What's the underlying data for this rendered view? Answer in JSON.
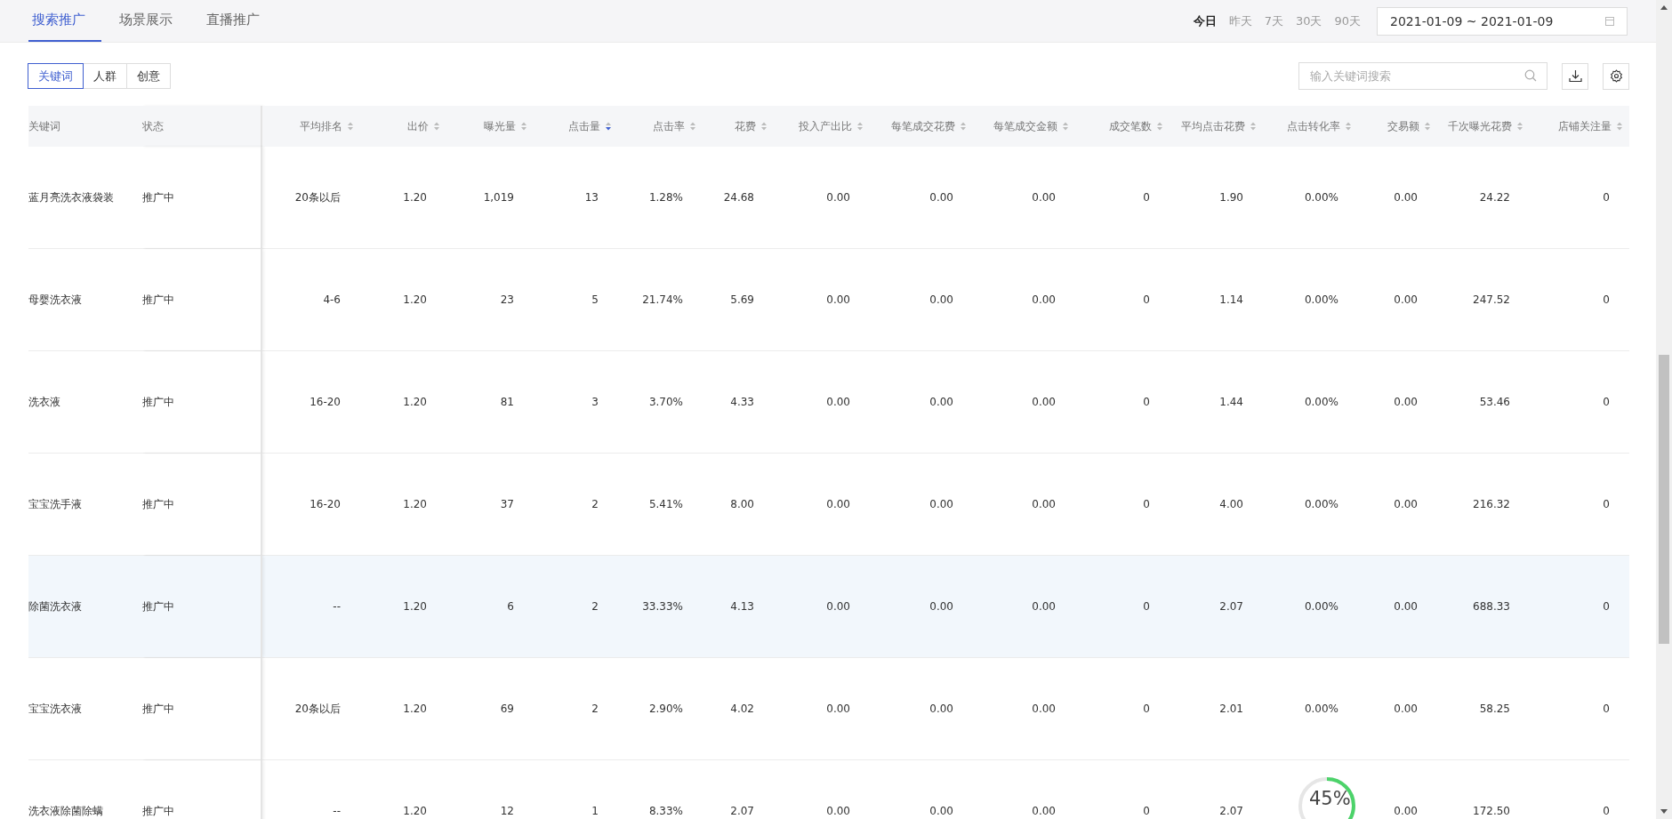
{
  "tabs": [
    {
      "label": "搜索推广",
      "selected": true
    },
    {
      "label": "场景展示",
      "selected": false
    },
    {
      "label": "直播推广",
      "selected": false
    }
  ],
  "date_ranges": [
    {
      "label": "今日",
      "selected": true
    },
    {
      "label": "昨天",
      "selected": false
    },
    {
      "label": "7天",
      "selected": false
    },
    {
      "label": "30天",
      "selected": false
    },
    {
      "label": "90天",
      "selected": false
    }
  ],
  "date_field": {
    "value": "2021-01-09 ~ 2021-01-09"
  },
  "segments": [
    {
      "label": "关键词",
      "selected": true
    },
    {
      "label": "人群",
      "selected": false
    },
    {
      "label": "创意",
      "selected": false
    }
  ],
  "search": {
    "placeholder": "输入关键词搜索"
  },
  "table": {
    "fixed_columns": [
      "关键词",
      "状态"
    ],
    "columns": [
      {
        "label": "平均排名",
        "sorted": false
      },
      {
        "label": "出价",
        "sorted": false
      },
      {
        "label": "曝光量",
        "sorted": false
      },
      {
        "label": "点击量",
        "sorted": true
      },
      {
        "label": "点击率",
        "sorted": false
      },
      {
        "label": "花费",
        "sorted": false
      },
      {
        "label": "投入产出比",
        "sorted": false
      },
      {
        "label": "每笔成交花费",
        "sorted": false
      },
      {
        "label": "每笔成交金额",
        "sorted": false
      },
      {
        "label": "成交笔数",
        "sorted": false
      },
      {
        "label": "平均点击花费",
        "sorted": false
      },
      {
        "label": "点击转化率",
        "sorted": false
      },
      {
        "label": "交易额",
        "sorted": false
      },
      {
        "label": "千次曝光花费",
        "sorted": false
      },
      {
        "label": "店铺关注量",
        "sorted": false
      }
    ],
    "rows": [
      {
        "keyword": "蓝月亮洗衣液袋装",
        "status": "推广中",
        "hovered": false,
        "cells": [
          "20条以后",
          "1.20",
          "1,019",
          "13",
          "1.28%",
          "24.68",
          "0.00",
          "0.00",
          "0.00",
          "0",
          "1.90",
          "0.00%",
          "0.00",
          "24.22",
          "0"
        ]
      },
      {
        "keyword": "母婴洗衣液",
        "status": "推广中",
        "hovered": false,
        "cells": [
          "4-6",
          "1.20",
          "23",
          "5",
          "21.74%",
          "5.69",
          "0.00",
          "0.00",
          "0.00",
          "0",
          "1.14",
          "0.00%",
          "0.00",
          "247.52",
          "0"
        ]
      },
      {
        "keyword": "洗衣液",
        "status": "推广中",
        "hovered": false,
        "cells": [
          "16-20",
          "1.20",
          "81",
          "3",
          "3.70%",
          "4.33",
          "0.00",
          "0.00",
          "0.00",
          "0",
          "1.44",
          "0.00%",
          "0.00",
          "53.46",
          "0"
        ]
      },
      {
        "keyword": "宝宝洗手液",
        "status": "推广中",
        "hovered": false,
        "cells": [
          "16-20",
          "1.20",
          "37",
          "2",
          "5.41%",
          "8.00",
          "0.00",
          "0.00",
          "0.00",
          "0",
          "4.00",
          "0.00%",
          "0.00",
          "216.32",
          "0"
        ]
      },
      {
        "keyword": "除菌洗衣液",
        "status": "推广中",
        "hovered": true,
        "cells": [
          "--",
          "1.20",
          "6",
          "2",
          "33.33%",
          "4.13",
          "0.00",
          "0.00",
          "0.00",
          "0",
          "2.07",
          "0.00%",
          "0.00",
          "688.33",
          "0"
        ]
      },
      {
        "keyword": "宝宝洗衣液",
        "status": "推广中",
        "hovered": false,
        "cells": [
          "20条以后",
          "1.20",
          "69",
          "2",
          "2.90%",
          "4.02",
          "0.00",
          "0.00",
          "0.00",
          "0",
          "2.01",
          "0.00%",
          "0.00",
          "58.25",
          "0"
        ]
      },
      {
        "keyword": "洗衣液除菌除螨",
        "status": "推广中",
        "hovered": false,
        "cells": [
          "--",
          "1.20",
          "12",
          "1",
          "8.33%",
          "2.07",
          "0.00",
          "0.00",
          "0.00",
          "0",
          "2.07",
          null,
          "0.00",
          "172.50",
          "0"
        ]
      }
    ]
  },
  "speed_widget": {
    "reading": "45%"
  }
}
